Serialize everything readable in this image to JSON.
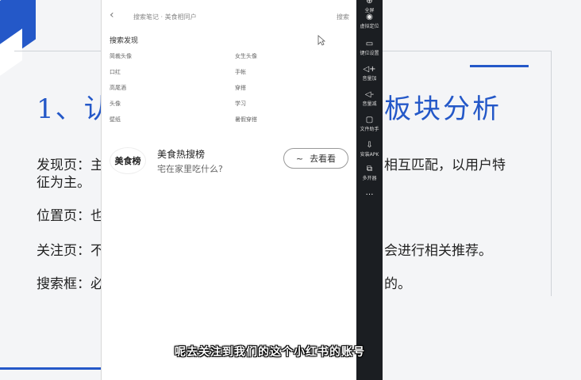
{
  "slide": {
    "title_left": "1、认",
    "title_right": "板块分析",
    "lines": [
      {
        "left": "发现页：主",
        "right": "相互匹配，以用户特"
      },
      {
        "left": "征为主。",
        "right": ""
      },
      {
        "left": "位置页：也",
        "right": ""
      },
      {
        "left": "关注页：不",
        "right": "会进行相关推荐。"
      },
      {
        "left": "搜索框：必",
        "right": "的。"
      }
    ]
  },
  "phone": {
    "back_glyph": "‹",
    "search_text": "搜索笔记 · 美食相同户",
    "header_right": "搜索",
    "section_title": "搜索发现",
    "keywords": [
      "简裁头像",
      "女生头像",
      "口红",
      "手帐",
      "高尾酒",
      "穿搭",
      "头像",
      "学习",
      "壁纸",
      "暑假穿搭"
    ],
    "hot": {
      "logo_text": "美食榜",
      "title": "美食热搜榜",
      "subtitle": "宅在家里吃什么?",
      "button_icon": "~",
      "button_label": "去看看"
    }
  },
  "sidebar": {
    "items": [
      {
        "icon": "⊕",
        "label": "全屏"
      },
      {
        "icon": "◉",
        "label": "虚拟定位"
      },
      {
        "icon": "▭",
        "label": "键位设置"
      },
      {
        "icon": "◁+",
        "label": "音量加"
      },
      {
        "icon": "◁-",
        "label": "音量减"
      },
      {
        "icon": "▢",
        "label": "文件助手"
      },
      {
        "icon": "⇩",
        "label": "安装APK"
      },
      {
        "icon": "⧉",
        "label": "多开器"
      },
      {
        "icon": "…",
        "label": ""
      }
    ]
  },
  "caption": "呢去关注到我们的这个小红书的账号",
  "colors": {
    "accent": "#2458c8",
    "sidebar": "#1b1e22"
  }
}
